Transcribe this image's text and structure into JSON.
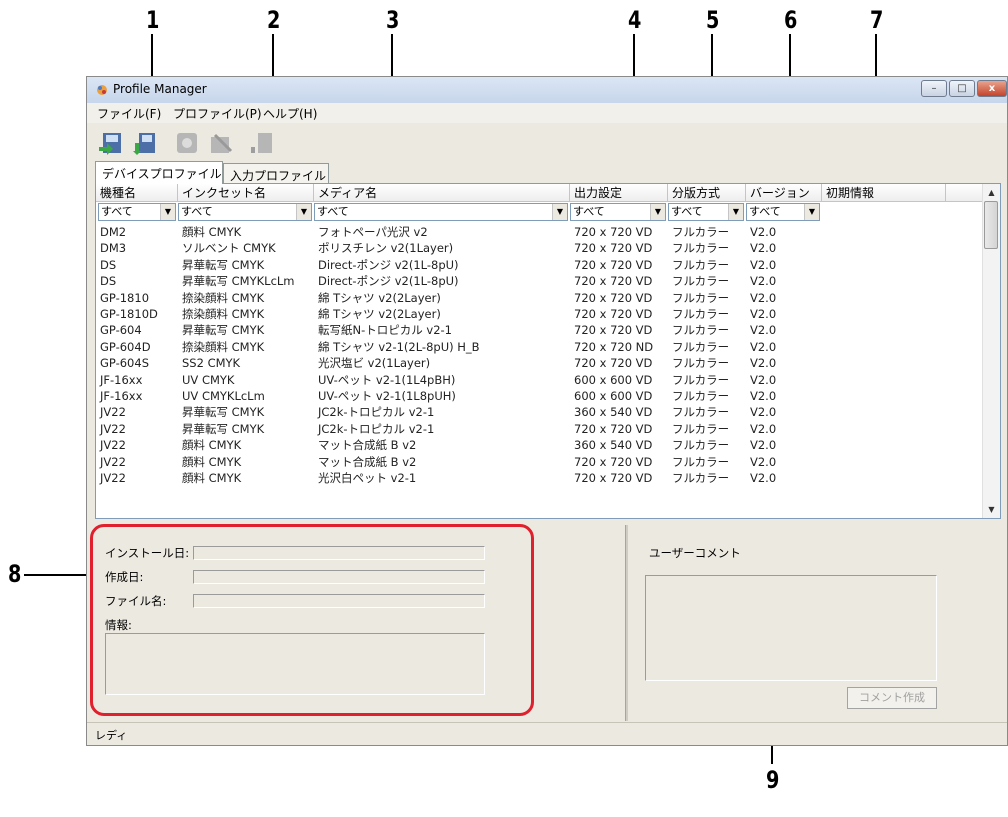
{
  "window": {
    "title": "Profile Manager",
    "controls": {
      "minimize": "–",
      "maximize": "□",
      "close": "x"
    }
  },
  "menu": [
    "ファイル(F)",
    "プロファイル(P)",
    "ヘルプ(H)"
  ],
  "tabs": [
    "デバイスプロファイル",
    "入力プロファイル"
  ],
  "columns": [
    "機種名",
    "インクセット名",
    "メディア名",
    "出力設定",
    "分版方式",
    "バージョン",
    "初期情報"
  ],
  "filters": [
    "すべて",
    "すべて",
    "すべて",
    "すべて",
    "すべて",
    "すべて"
  ],
  "rows": [
    [
      "DM2",
      "顔料 CMYK",
      "フォトペーパ光沢 v2",
      "720 x 720 VD",
      "フルカラー",
      "V2.0"
    ],
    [
      "DM3",
      "ソルベント CMYK",
      "ポリスチレン v2(1Layer)",
      "720 x 720 VD",
      "フルカラー",
      "V2.0"
    ],
    [
      "DS",
      "昇華転写 CMYK",
      "Direct-ポンジ v2(1L-8pU)",
      "720 x 720 VD",
      "フルカラー",
      "V2.0"
    ],
    [
      "DS",
      "昇華転写 CMYKLcLm",
      "Direct-ポンジ v2(1L-8pU)",
      "720 x 720 VD",
      "フルカラー",
      "V2.0"
    ],
    [
      "GP-1810",
      "捺染顔料 CMYK",
      "綿 Tシャツ v2(2Layer)",
      "720 x 720 VD",
      "フルカラー",
      "V2.0"
    ],
    [
      "GP-1810D",
      "捺染顔料 CMYK",
      "綿 Tシャツ v2(2Layer)",
      "720 x 720 VD",
      "フルカラー",
      "V2.0"
    ],
    [
      "GP-604",
      "昇華転写 CMYK",
      "転写紙N-トロピカル v2-1",
      "720 x 720 VD",
      "フルカラー",
      "V2.0"
    ],
    [
      "GP-604D",
      "捺染顔料 CMYK",
      "綿 Tシャツ v2-1(2L-8pU) H_B",
      "720 x 720 ND",
      "フルカラー",
      "V2.0"
    ],
    [
      "GP-604S",
      "SS2 CMYK",
      "光沢塩ビ v2(1Layer)",
      "720 x 720 VD",
      "フルカラー",
      "V2.0"
    ],
    [
      "JF-16xx",
      "UV CMYK",
      "UV-ペット v2-1(1L4pBH)",
      "600 x 600 VD",
      "フルカラー",
      "V2.0"
    ],
    [
      "JF-16xx",
      "UV CMYKLcLm",
      "UV-ペット v2-1(1L8pUH)",
      "600 x 600 VD",
      "フルカラー",
      "V2.0"
    ],
    [
      "JV22",
      "昇華転写 CMYK",
      "JC2k-トロピカル v2-1",
      "360 x 540 VD",
      "フルカラー",
      "V2.0"
    ],
    [
      "JV22",
      "昇華転写 CMYK",
      "JC2k-トロピカル v2-1",
      "720 x 720 VD",
      "フルカラー",
      "V2.0"
    ],
    [
      "JV22",
      "顔料 CMYK",
      "マット合成紙 B v2",
      "360 x 540 VD",
      "フルカラー",
      "V2.0"
    ],
    [
      "JV22",
      "顔料 CMYK",
      "マット合成紙 B v2",
      "720 x 720 VD",
      "フルカラー",
      "V2.0"
    ],
    [
      "JV22",
      "顔料 CMYK",
      "光沢白ペット v2-1",
      "720 x 720 VD",
      "フルカラー",
      "V2.0"
    ]
  ],
  "info": {
    "install_date_label": "インストール日:",
    "created_date_label": "作成日:",
    "file_name_label": "ファイル名:",
    "info_label": "情報:",
    "user_comment_label": "ユーザーコメント",
    "create_comment_button": "コメント作成"
  },
  "status": "レディ",
  "callouts": [
    "1",
    "2",
    "3",
    "4",
    "5",
    "6",
    "7",
    "8",
    "9"
  ],
  "colors": {
    "highlight": "#e0202c",
    "list_border": "#7f9db9"
  }
}
